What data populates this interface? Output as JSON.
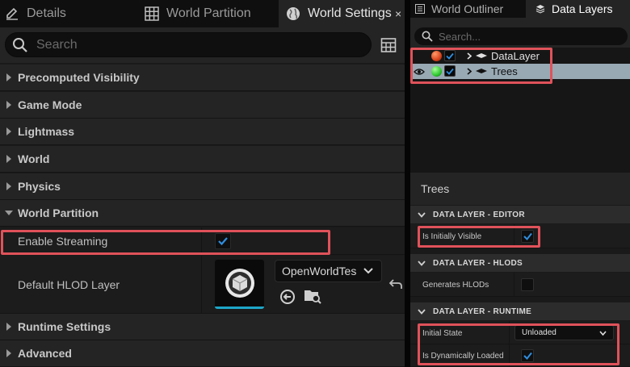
{
  "left_panel": {
    "tabs": [
      {
        "label": "Details",
        "icon": "pencil-icon"
      },
      {
        "label": "World Partition",
        "icon": "grid-icon"
      },
      {
        "label": "World Settings",
        "icon": "globe-icon"
      }
    ],
    "close_glyph": "×",
    "search_placeholder": "Search",
    "categories": {
      "precomputed_visibility": "Precomputed Visibility",
      "game_mode": "Game Mode",
      "lightmass": "Lightmass",
      "world": "World",
      "physics": "Physics",
      "world_partition": "World Partition",
      "runtime_settings": "Runtime Settings",
      "advanced": "Advanced"
    },
    "properties": {
      "enable_streaming": {
        "label": "Enable Streaming",
        "checked": true
      },
      "default_hlod_layer": {
        "label": "Default HLOD Layer",
        "value": "OpenWorldTes"
      }
    }
  },
  "right_panel": {
    "tabs": [
      {
        "label": "World Outliner",
        "icon": "list-icon"
      },
      {
        "label": "Data Layers",
        "icon": "layers-icon"
      }
    ],
    "search_placeholder": "Search...",
    "layers": [
      {
        "name": "DataLayer",
        "status_color": "#d9441c",
        "checked": true,
        "eye": false
      },
      {
        "name": "Trees",
        "status_color": "#2fc82f",
        "checked": true,
        "eye": true,
        "selected": true
      }
    ],
    "details_title": "Trees",
    "sections": {
      "editor": "DATA LAYER - EDITOR",
      "hlods": "DATA LAYER - HLODS",
      "runtime": "DATA LAYER - RUNTIME"
    },
    "props": {
      "is_initially_visible": {
        "label": "Is Initially Visible",
        "checked": true
      },
      "generates_hlods": {
        "label": "Generates HLODs",
        "checked": false
      },
      "initial_state": {
        "label": "Initial State",
        "value": "Unloaded"
      },
      "is_dynamically_loaded": {
        "label": "Is Dynamically Loaded",
        "checked": true
      }
    }
  },
  "colors": {
    "highlight": "#e0525a",
    "accent_blue": "#2f8fe0",
    "selection": "#98a9b3",
    "thumb_underline": "#1ea7c8"
  }
}
